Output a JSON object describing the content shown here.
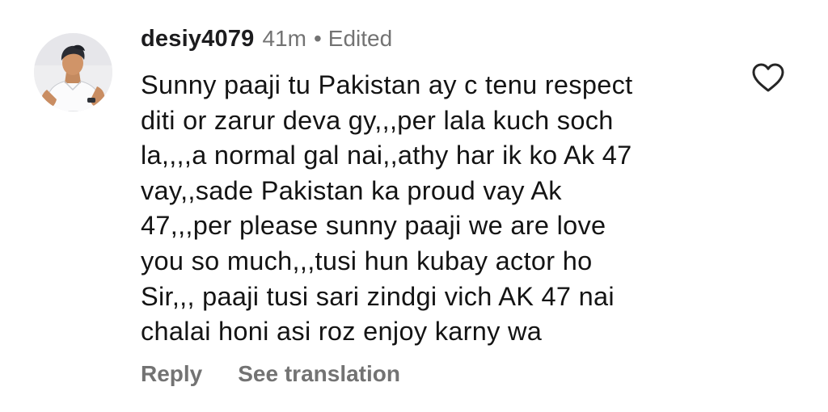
{
  "comment": {
    "username": "desiy4079",
    "time": "41m",
    "separator": "•",
    "edited_label": "Edited",
    "text_lines": [
      "Sunny paaji tu Pakistan ay c tenu respect",
      "diti or zarur deva gy,,,per lala kuch soch",
      "la,,,,a normal gal nai,,athy har ik ko Ak 47",
      "vay,,sade Pakistan ka proud vay Ak",
      "47,,,per please sunny paaji we are love",
      "you so much,,,tusi hun kubay actor ho",
      "Sir,,, paaji tusi sari zindgi vich AK 47 nai",
      "chalai honi asi roz enjoy karny wa"
    ],
    "actions": {
      "reply_label": "Reply",
      "translate_label": "See translation"
    },
    "like_icon": "heart-outline-icon"
  },
  "colors": {
    "text_primary": "#141414",
    "text_secondary": "#737373",
    "background": "#ffffff"
  }
}
